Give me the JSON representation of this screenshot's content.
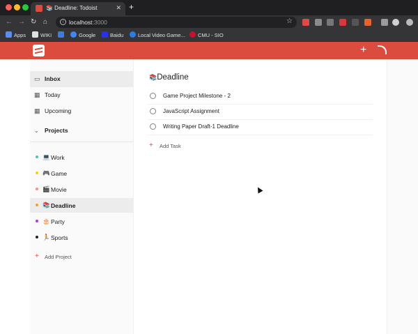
{
  "browser": {
    "tab_title": "📚 Deadline: Todoist",
    "tab_close": "✕",
    "new_tab": "+",
    "url_host": "localhost",
    "url_port": ":3000",
    "bookmarks": [
      {
        "label": "Apps",
        "color": "#5b8def"
      },
      {
        "label": "WIKI",
        "color": "#e0e0e0"
      },
      {
        "label": "",
        "color": "#3d7be0"
      },
      {
        "label": "Google",
        "color": "#4285f4"
      },
      {
        "label": "Baidu",
        "color": "#2932e1"
      },
      {
        "label": "Local Video Game...",
        "color": "#2c7be5"
      },
      {
        "label": "CMU - SIO",
        "color": "#c41230"
      }
    ]
  },
  "header": {
    "add_icon": "+",
    "brand_color": "#db4c3f"
  },
  "sidebar": {
    "nav": [
      {
        "label": "Inbox",
        "icon": "inbox-icon",
        "glyph": "▭",
        "active": true
      },
      {
        "label": "Today",
        "icon": "calendar-today-icon",
        "glyph": "▦"
      },
      {
        "label": "Upcoming",
        "icon": "calendar-upcoming-icon",
        "glyph": "▦"
      }
    ],
    "projects_header": "Projects",
    "projects": [
      {
        "emoji": "💻",
        "label": "Work",
        "dot": "#4fc3b8"
      },
      {
        "emoji": "🎮",
        "label": "Game",
        "dot": "#fad000"
      },
      {
        "emoji": "🎬",
        "label": "Movie",
        "dot": "#ff8d85"
      },
      {
        "emoji": "📚",
        "label": "Deadline",
        "dot": "#ff9933",
        "active": true
      },
      {
        "emoji": "🎂",
        "label": "Party",
        "dot": "#af38eb"
      },
      {
        "emoji": "🏃",
        "label": "Sports",
        "dot": "#222222"
      }
    ],
    "add_project": "Add Project",
    "add_icon": "+"
  },
  "main": {
    "title_emoji": "📚",
    "title": "Deadline",
    "tasks": [
      "Game Project Milestone - 2",
      "JavaScript Assignment",
      "Writing Paper Draft-1 Deadline"
    ],
    "add_task": "Add Task",
    "add_icon": "+"
  }
}
